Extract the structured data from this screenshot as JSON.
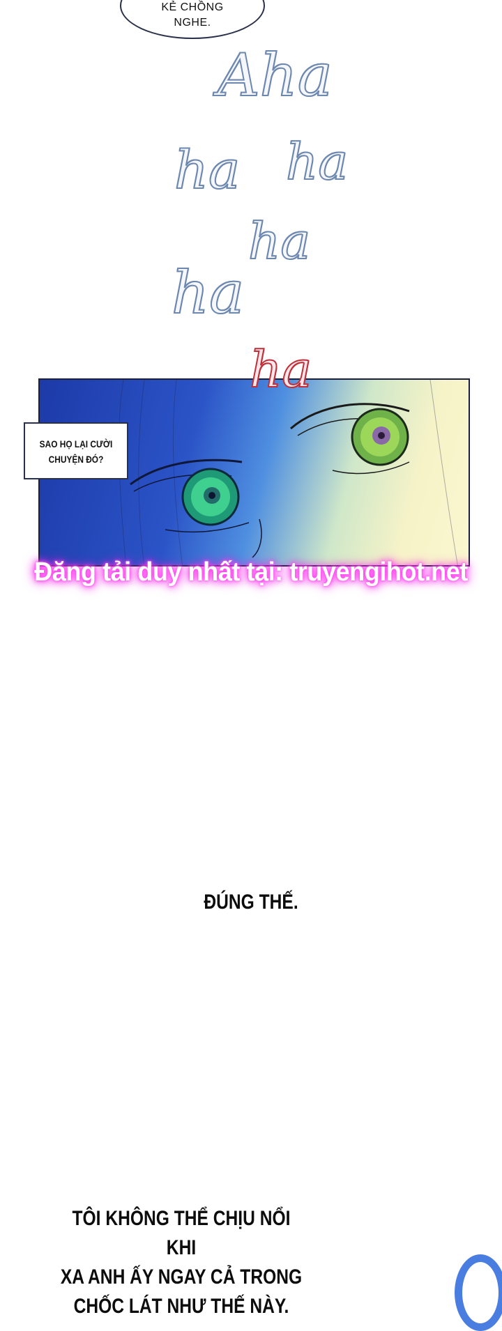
{
  "bubble_top": {
    "line1": "KẺ CHỒNG",
    "line2": "NGHE."
  },
  "laughter": [
    "Aha",
    "ha",
    "ha",
    "ha",
    "ha",
    "ha"
  ],
  "caption": {
    "line1": "SAO HỌ LẠI CƯỜI",
    "line2": "CHUYỆN ĐÓ?"
  },
  "watermark": "Đăng tải duy nhất tại: truyengihot.net",
  "narration_1": "ĐÚNG THẾ.",
  "narration_2": {
    "line1": "TÔI KHÔNG THỂ CHỊU NỔI KHI",
    "line2": "XA ANH ẤY NGAY CẢ TRONG",
    "line3": "CHỐC LÁT NHƯ THẾ NÀY."
  },
  "colors": {
    "laugh_outline": "#6d88b0",
    "laugh_red": "#c0303a",
    "watermark_glow": "#ff3df0",
    "eye_green": "#3fb873"
  }
}
